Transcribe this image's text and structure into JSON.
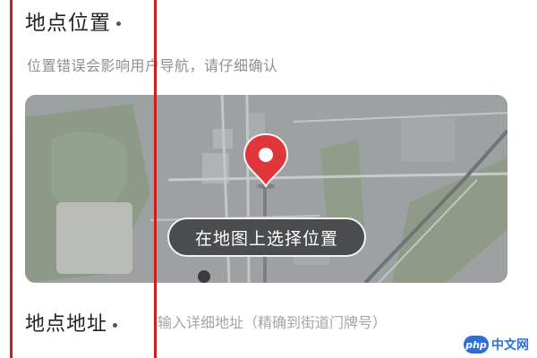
{
  "location": {
    "title": "地点位置",
    "hint": "位置错误会影响用户导航，请仔细确认",
    "map_button_label": "在地图上选择位置"
  },
  "address": {
    "label": "地点地址",
    "placeholder": "输入详细地址（精确到街道门牌号）"
  },
  "watermark": {
    "logo": "php",
    "text": "中文网"
  },
  "colors": {
    "pin": "#e0353a",
    "map_button_bg": "#4a4c4d",
    "guide_line": "#c8201e"
  }
}
